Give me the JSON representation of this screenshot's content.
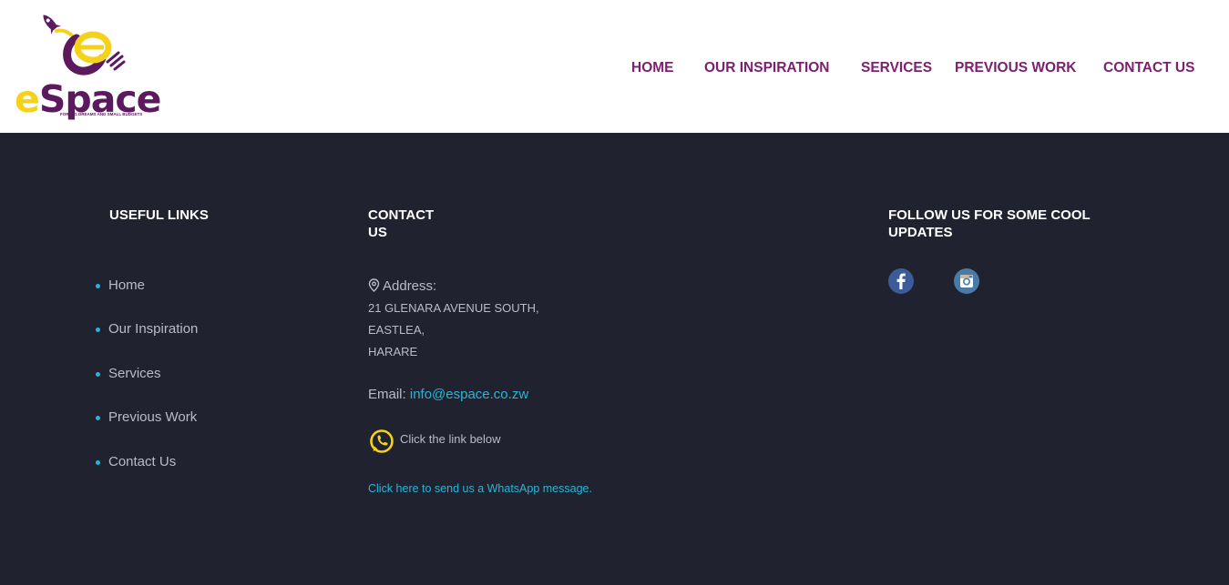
{
  "header": {
    "logo": {
      "wordmark_e": "e",
      "wordmark_rest": "Space",
      "tagline": "FOR BIG DREAMS AND SMALL BUDGETS"
    },
    "nav": [
      {
        "label": "HOME"
      },
      {
        "label": "OUR INSPIRATION"
      },
      {
        "label": "SERVICES"
      },
      {
        "label": "PREVIOUS WORK"
      },
      {
        "label": "CONTACT US"
      }
    ]
  },
  "footer": {
    "useful_links": {
      "title": "USEFUL LINKS",
      "items": [
        {
          "label": "Home"
        },
        {
          "label": "Our Inspiration"
        },
        {
          "label": "Services"
        },
        {
          "label": "Previous Work"
        },
        {
          "label": "Contact Us"
        }
      ]
    },
    "contact": {
      "title": "CONTACT US",
      "address_label": "Address:",
      "address_lines": [
        "21 GLENARA AVENUE SOUTH,",
        "EASTLEA,",
        "HARARE"
      ],
      "email_label": "Email:",
      "email": "info@espace.co.zw",
      "whatsapp_text": "Click the link below",
      "whatsapp_link": "Click here to send us a WhatsApp message."
    },
    "follow": {
      "title_line1": "FOLLOW US FOR SOME COOL",
      "title_line2": "UPDATES",
      "icons": [
        "facebook-icon",
        "instagram-icon"
      ]
    }
  },
  "colors": {
    "brand_purple": "#7b1f6e",
    "brand_yellow": "#f5d21a",
    "footer_bg": "#21222f",
    "link_cyan": "#27b6d8"
  }
}
